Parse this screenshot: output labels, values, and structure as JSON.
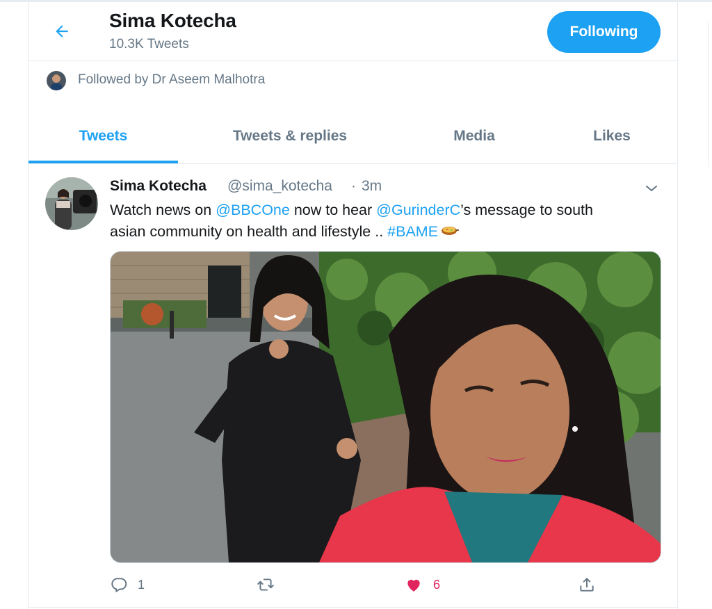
{
  "header": {
    "title": "Sima Kotecha",
    "tweet_count": "10.3K Tweets",
    "follow_button": "Following",
    "back_icon": "arrow-left-icon"
  },
  "followed_by": {
    "text": "Followed by Dr Aseem Malhotra"
  },
  "tabs": [
    {
      "label": "Tweets",
      "active": true
    },
    {
      "label": "Tweets & replies",
      "active": false
    },
    {
      "label": "Media",
      "active": false
    },
    {
      "label": "Likes",
      "active": false
    }
  ],
  "tweet": {
    "author_name": "Sima Kotecha",
    "handle": "@sima_kotecha",
    "separator": "·",
    "time": "3m",
    "text_segments": {
      "t1": "Watch news on ",
      "m1": "@BBCOne",
      "t2": " now to hear ",
      "m2": "@GurinderC",
      "t3": "’s message to south",
      "t4": "asian community on health and lifestyle .. ",
      "hashtag": "#BAME"
    },
    "emoji": "shallow-pan-of-food-icon",
    "actions": {
      "replies": "1",
      "retweets": "",
      "likes": "6",
      "liked": true
    }
  },
  "colors": {
    "accent": "#1da1f2",
    "secondary_text": "#657786",
    "like": "#e0245e",
    "border": "#e6ecf0"
  }
}
